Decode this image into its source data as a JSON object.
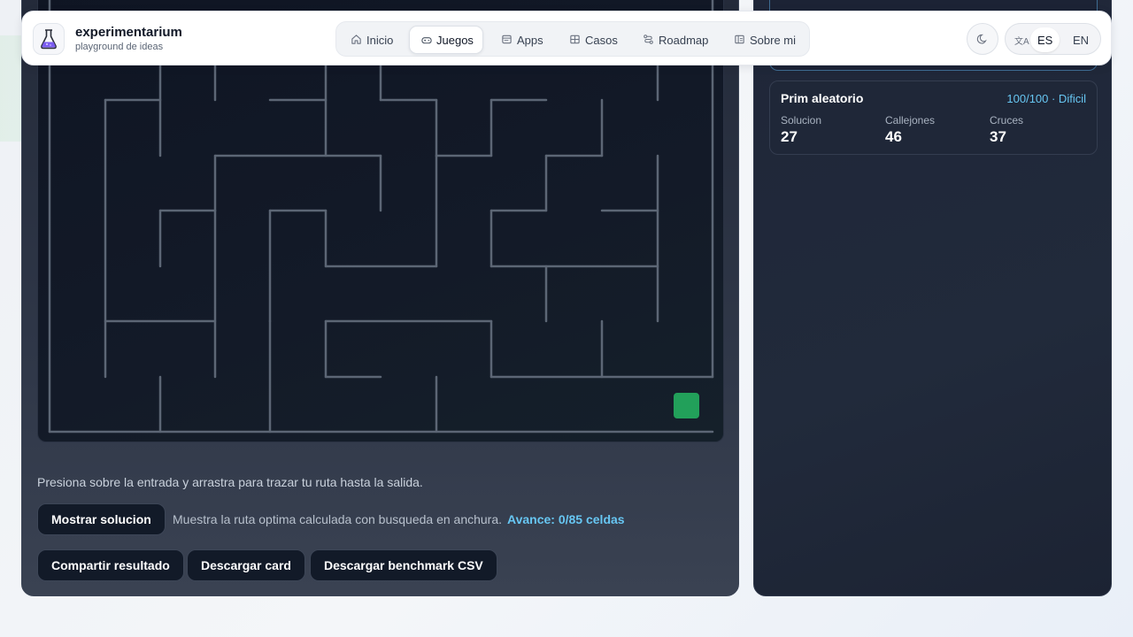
{
  "brand": {
    "name": "experimentarium",
    "tagline": "playground de ideas",
    "logo_icon": "flask-icon"
  },
  "nav": {
    "items": [
      {
        "label": "Inicio",
        "icon": "home-icon"
      },
      {
        "label": "Juegos",
        "icon": "gamepad-icon",
        "active": true
      },
      {
        "label": "Apps",
        "icon": "window-icon"
      },
      {
        "label": "Casos",
        "icon": "grid-icon"
      },
      {
        "label": "Roadmap",
        "icon": "route-icon"
      },
      {
        "label": "Sobre mi",
        "icon": "card-icon"
      }
    ]
  },
  "header_controls": {
    "theme_icon": "moon-icon",
    "lang_icon": "translate-icon",
    "languages": [
      "ES",
      "EN"
    ],
    "active_language": "ES"
  },
  "maze": {
    "hint": "Presiona sobre la entrada y arrastra para trazar tu ruta hasta la salida.",
    "exit_color": "#22a05a",
    "wall_color": "#5c6675"
  },
  "actions": {
    "show_solution": "Mostrar solucion",
    "solution_desc": "Muestra la ruta optima calculada con busqueda en anchura.",
    "progress": "Avance: 0/85 celdas",
    "share": "Compartir resultado",
    "download_card": "Descargar card",
    "download_csv": "Descargar benchmark CSV"
  },
  "stats": {
    "title": "Prim aleatorio",
    "meta": "100/100 · Dificil",
    "items": [
      {
        "label": "Solucion",
        "value": "27"
      },
      {
        "label": "Callejones",
        "value": "46"
      },
      {
        "label": "Cruces",
        "value": "37"
      }
    ]
  },
  "colors": {
    "accent": "#67c6f2",
    "panel_dark": "#1f2638",
    "nav_active_bg": "#ffffff"
  }
}
